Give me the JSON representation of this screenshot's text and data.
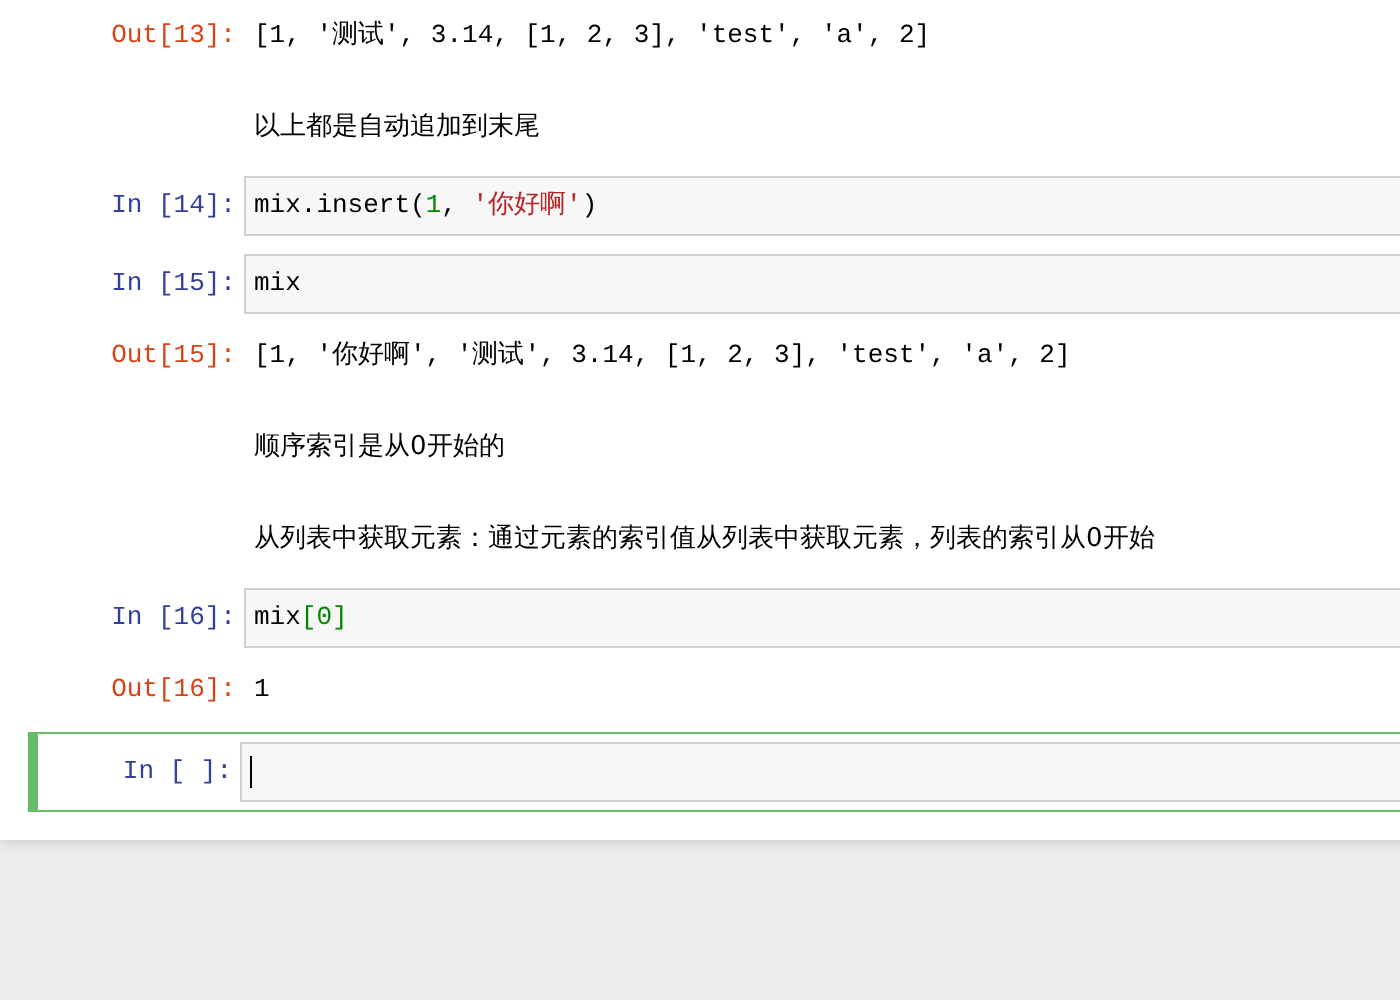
{
  "cells": [
    {
      "kind": "output",
      "prompt": "Out[13]:",
      "text": "[1, '测试', 3.14, [1, 2, 3], 'test', 'a', 2]"
    },
    {
      "kind": "markdown",
      "text": "以上都是自动追加到末尾"
    },
    {
      "kind": "code",
      "prompt": "In [14]:",
      "selected": false,
      "tokens": [
        {
          "kind": "name",
          "text": "mix.insert("
        },
        {
          "kind": "number",
          "text": "1"
        },
        {
          "kind": "name",
          "text": ", "
        },
        {
          "kind": "string",
          "text": "'你好啊'"
        },
        {
          "kind": "name",
          "text": ")"
        }
      ]
    },
    {
      "kind": "code",
      "prompt": "In [15]:",
      "selected": false,
      "tokens": [
        {
          "kind": "name",
          "text": "mix"
        }
      ]
    },
    {
      "kind": "output",
      "prompt": "Out[15]:",
      "text": "[1, '你好啊', '测试', 3.14, [1, 2, 3], 'test', 'a', 2]"
    },
    {
      "kind": "markdown",
      "text": "顺序索引是从0开始的"
    },
    {
      "kind": "markdown",
      "text": "从列表中获取元素：通过元素的索引值从列表中获取元素，列表的索引从0开始"
    },
    {
      "kind": "code",
      "prompt": "In [16]:",
      "selected": false,
      "tokens": [
        {
          "kind": "name",
          "text": "mix"
        },
        {
          "kind": "number",
          "text": "[0]"
        }
      ]
    },
    {
      "kind": "output",
      "prompt": "Out[16]:",
      "text": "1"
    },
    {
      "kind": "code",
      "prompt": "In [ ]:",
      "selected": true
    }
  ]
}
